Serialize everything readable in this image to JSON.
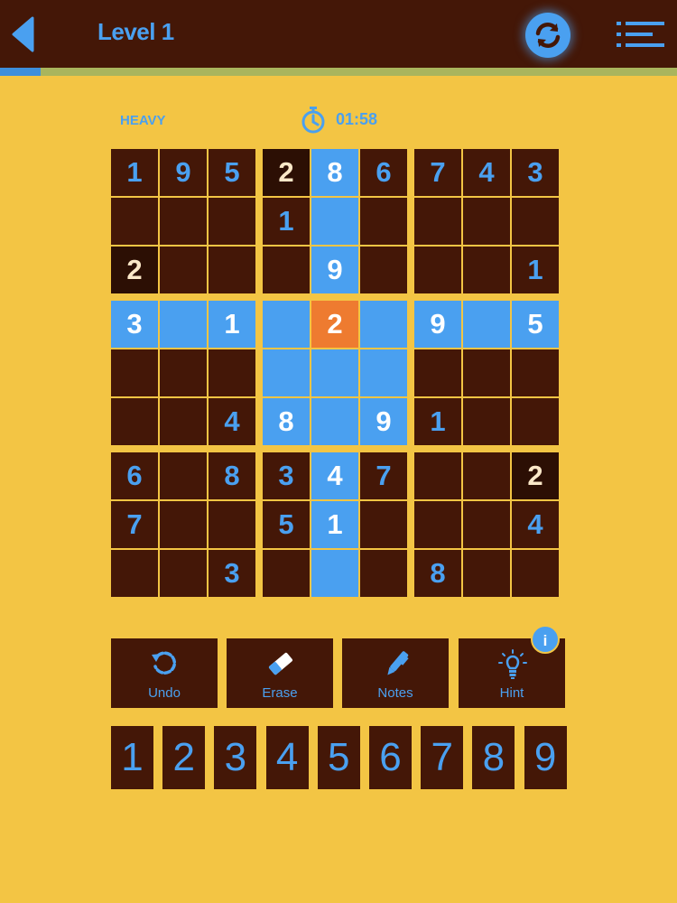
{
  "header": {
    "title": "Level 1",
    "back_icon": "back-arrow-icon",
    "restart_icon": "restart-icon",
    "menu_icon": "menu-list-icon",
    "progress": 0.06
  },
  "status": {
    "difficulty": "HEAVY",
    "timer": "01:58",
    "timer_icon": "stopwatch-icon"
  },
  "board": {
    "givens": [
      [
        1,
        9,
        5,
        2,
        8,
        6,
        7,
        4,
        3
      ],
      [
        0,
        0,
        0,
        1,
        0,
        0,
        0,
        0,
        0
      ],
      [
        2,
        0,
        0,
        0,
        9,
        0,
        0,
        0,
        1
      ],
      [
        3,
        0,
        1,
        0,
        2,
        0,
        9,
        0,
        5
      ],
      [
        0,
        0,
        0,
        0,
        0,
        0,
        0,
        0,
        0
      ],
      [
        0,
        0,
        4,
        8,
        0,
        9,
        1,
        0,
        0
      ],
      [
        6,
        0,
        8,
        3,
        4,
        7,
        0,
        0,
        2
      ],
      [
        7,
        0,
        0,
        5,
        1,
        0,
        0,
        0,
        4
      ],
      [
        0,
        0,
        3,
        0,
        0,
        0,
        8,
        0,
        0
      ]
    ],
    "selected": [
      3,
      4
    ],
    "same_number_value": 2
  },
  "tools": [
    {
      "label": "Undo",
      "icon": "undo-icon"
    },
    {
      "label": "Erase",
      "icon": "eraser-icon"
    },
    {
      "label": "Notes",
      "icon": "pen-icon"
    },
    {
      "label": "Hint",
      "icon": "lightbulb-icon"
    }
  ],
  "hint_badge": "i",
  "numpad": [
    "1",
    "2",
    "3",
    "4",
    "5",
    "6",
    "7",
    "8",
    "9"
  ],
  "colors": {
    "background": "#f3c544",
    "dark": "#441707",
    "darker": "#2c0f04",
    "blue": "#4aa0f0",
    "highlight": "#4aa0f0",
    "selected": "#ee7b30",
    "white": "#ffffff",
    "cream": "#fbe8c8"
  }
}
